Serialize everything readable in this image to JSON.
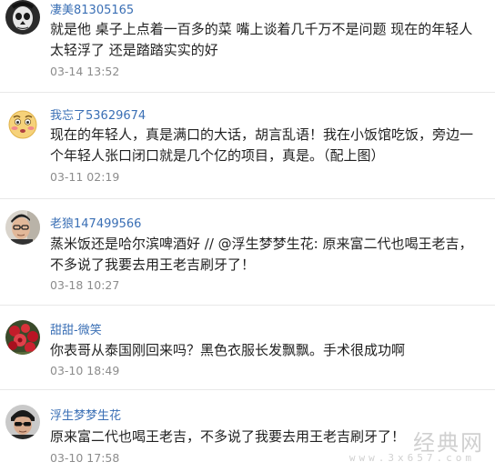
{
  "comments": [
    {
      "username": "凄美81305165",
      "text": "就是他 桌子上点着一百多的菜 嘴上谈着几千万不是问题 现在的年轻人太轻浮了 还是踏踏实实的好",
      "time": "03-14 13:52",
      "avatar": "skull-mask-avatar"
    },
    {
      "username": "我忘了53629674",
      "text": "现在的年轻人，真是满口的大话，胡言乱语！我在小饭馆吃饭，旁边一个年轻人张口闭口就是几个亿的项目，真是。（配上图）",
      "time": "03-11 02:19",
      "avatar": "blushing-emoji-avatar"
    },
    {
      "username": "老狼147499566",
      "text": "蒸米饭还是哈尔滨啤酒好 // @浮生梦梦生花: 原来富二代也喝王老吉，不多说了我要去用王老吉刷牙了！",
      "time": "03-18 10:27",
      "avatar": "man-glasses-avatar"
    },
    {
      "username": "甜甜-微笑",
      "text": "你表哥从泰国刚回来吗？黑色衣服长发飘飘。手术很成功啊",
      "time": "03-10 18:49",
      "avatar": "red-flowers-avatar"
    },
    {
      "username": "浮生梦梦生花",
      "text": "原来富二代也喝王老吉，不多说了我要去用王老吉刷牙了！",
      "time": "03-10 17:58",
      "avatar": "man-sunglasses-avatar"
    }
  ],
  "watermark": {
    "main": "经典网",
    "sub": "www.3x657.com"
  }
}
